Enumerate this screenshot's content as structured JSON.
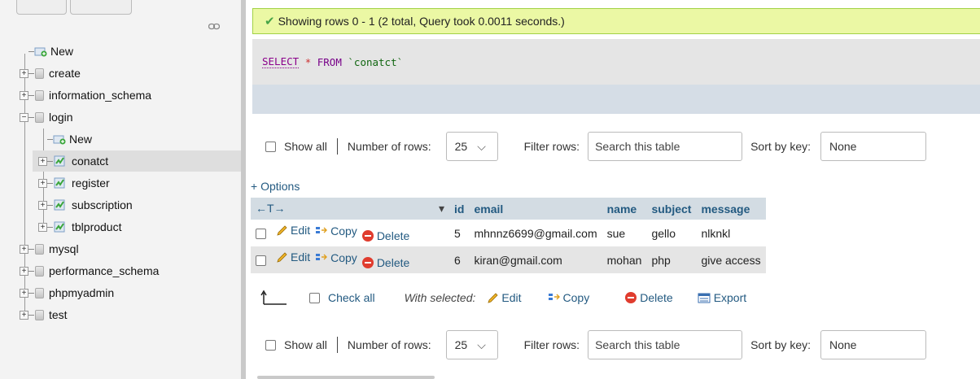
{
  "sidebar": {
    "items": [
      {
        "label": "New",
        "kind": "new",
        "level": 0
      },
      {
        "label": "create",
        "kind": "db",
        "level": 0,
        "expander": "+"
      },
      {
        "label": "information_schema",
        "kind": "db",
        "level": 0,
        "expander": "+"
      },
      {
        "label": "login",
        "kind": "db",
        "level": 0,
        "expander": "−"
      },
      {
        "label": "New",
        "kind": "new",
        "level": 1
      },
      {
        "label": "conatct",
        "kind": "table",
        "level": 1,
        "expander": "+",
        "selected": true
      },
      {
        "label": "register",
        "kind": "table",
        "level": 1,
        "expander": "+"
      },
      {
        "label": "subscription",
        "kind": "table",
        "level": 1,
        "expander": "+"
      },
      {
        "label": "tblproduct",
        "kind": "table",
        "level": 1,
        "expander": "+"
      },
      {
        "label": "mysql",
        "kind": "db",
        "level": 0,
        "expander": "+"
      },
      {
        "label": "performance_schema",
        "kind": "db",
        "level": 0,
        "expander": "+"
      },
      {
        "label": "phpmyadmin",
        "kind": "db",
        "level": 0,
        "expander": "+"
      },
      {
        "label": "test",
        "kind": "db",
        "level": 0,
        "expander": "+"
      }
    ]
  },
  "message": {
    "success": "Showing rows 0 - 1 (2 total, Query took 0.0011 seconds.)"
  },
  "sql": {
    "select": "SELECT",
    "star": "*",
    "from": "FROM",
    "table": "`conatct`"
  },
  "nav": {
    "show_all": "Show all",
    "number_of_rows_label": "Number of rows:",
    "number_of_rows_value": "25",
    "filter_label": "Filter rows:",
    "filter_placeholder": "Search this table",
    "sort_label": "Sort by key:",
    "sort_value": "None"
  },
  "options_link": "+ Options",
  "table": {
    "sort_arrows": "←T→",
    "columns": [
      "id",
      "email",
      "name",
      "subject",
      "message"
    ],
    "row_actions": {
      "edit": "Edit",
      "copy": "Copy",
      "delete": "Delete"
    },
    "rows": [
      {
        "id": "5",
        "email": "mhnnz6699@gmail.com",
        "name": "sue",
        "subject": "gello",
        "message": "nlknkl"
      },
      {
        "id": "6",
        "email": "kiran@gmail.com",
        "name": "mohan",
        "subject": "php",
        "message": "give access"
      }
    ]
  },
  "bulk": {
    "check_all": "Check all",
    "with_selected": "With selected:",
    "edit": "Edit",
    "copy": "Copy",
    "delete": "Delete",
    "export": "Export"
  },
  "colors": {
    "success_bg": "#ebf8a4",
    "header_bg": "#d3dce3",
    "link": "#235a81",
    "delete_red": "#e03c2e"
  }
}
